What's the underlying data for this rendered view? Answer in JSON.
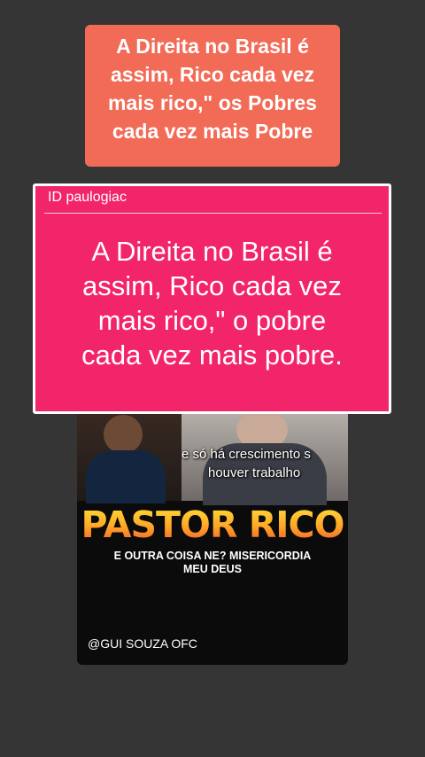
{
  "top_caption": {
    "line1": "A Direita no Brasil é",
    "line2": "assim, Rico cada vez",
    "line3": "mais rico,\" os Pobres",
    "line4": "cada vez mais Pobre"
  },
  "overlay_card": {
    "id_label": "ID  paulogiac",
    "line1": "A Direita no Brasil é",
    "line2": "assim, Rico cada vez",
    "line3": "mais rico,\" o pobre",
    "line4": "cada vez mais pobre."
  },
  "video": {
    "subtitle_line1": "e só há crescimento s",
    "subtitle_line2": "houver trabalho",
    "headline": "PASTOR RICO",
    "headline_sub_line1": "E OUTRA COISA NE? MISERICORDIA",
    "headline_sub_line2": "MEU DEUS",
    "handle": "@GUI SOUZA OFC"
  },
  "colors": {
    "background": "#353535",
    "caption_bg": "#f26b57",
    "card_bg": "#f2256b",
    "headline_gradient": [
      "#ffe23a",
      "#ffa526",
      "#f0512a"
    ]
  }
}
